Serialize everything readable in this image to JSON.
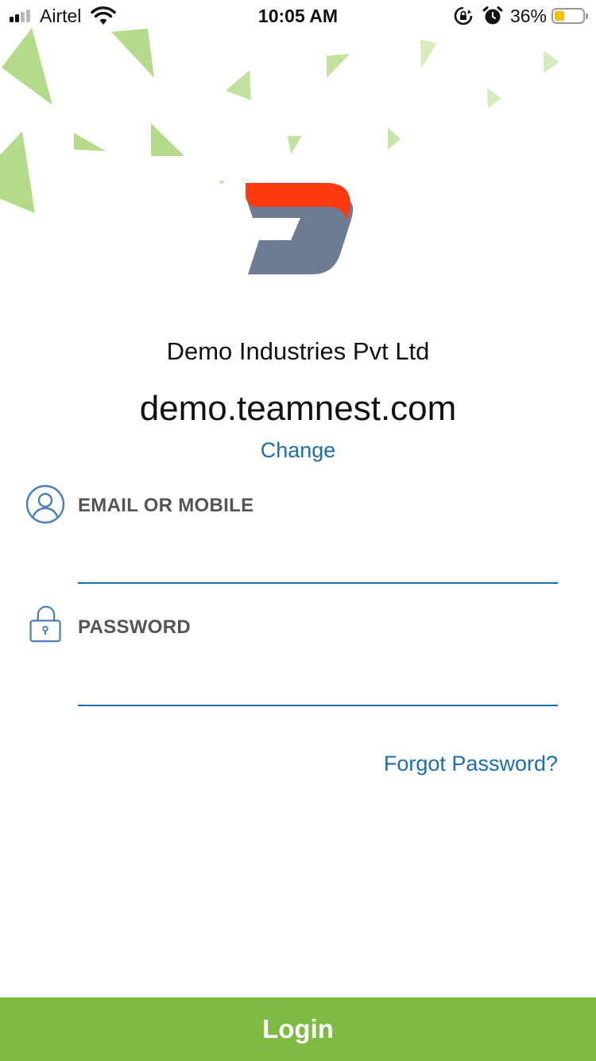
{
  "status_bar": {
    "carrier": "Airtel",
    "time": "10:05 AM",
    "battery_percent": "36%",
    "battery_level": 0.36,
    "signal_bars": 2,
    "icons": [
      "signal-icon",
      "wifi-icon",
      "rotation-lock-icon",
      "alarm-icon",
      "battery-icon"
    ]
  },
  "company": {
    "logo_icon": "company-logo-d-icon",
    "name": "Demo Industries Pvt Ltd",
    "domain": "demo.teamnest.com",
    "change_label": "Change"
  },
  "form": {
    "email_label": "EMAIL OR MOBILE",
    "email_value": "",
    "email_icon": "user-icon",
    "password_label": "PASSWORD",
    "password_value": "",
    "password_icon": "lock-icon",
    "forgot_label": "Forgot Password?"
  },
  "login_label": "Login",
  "colors": {
    "accent_green": "#7dbb42",
    "link_blue": "#1a6eb0",
    "logo_red": "#ff3a12",
    "logo_gray": "#6e7c93"
  }
}
